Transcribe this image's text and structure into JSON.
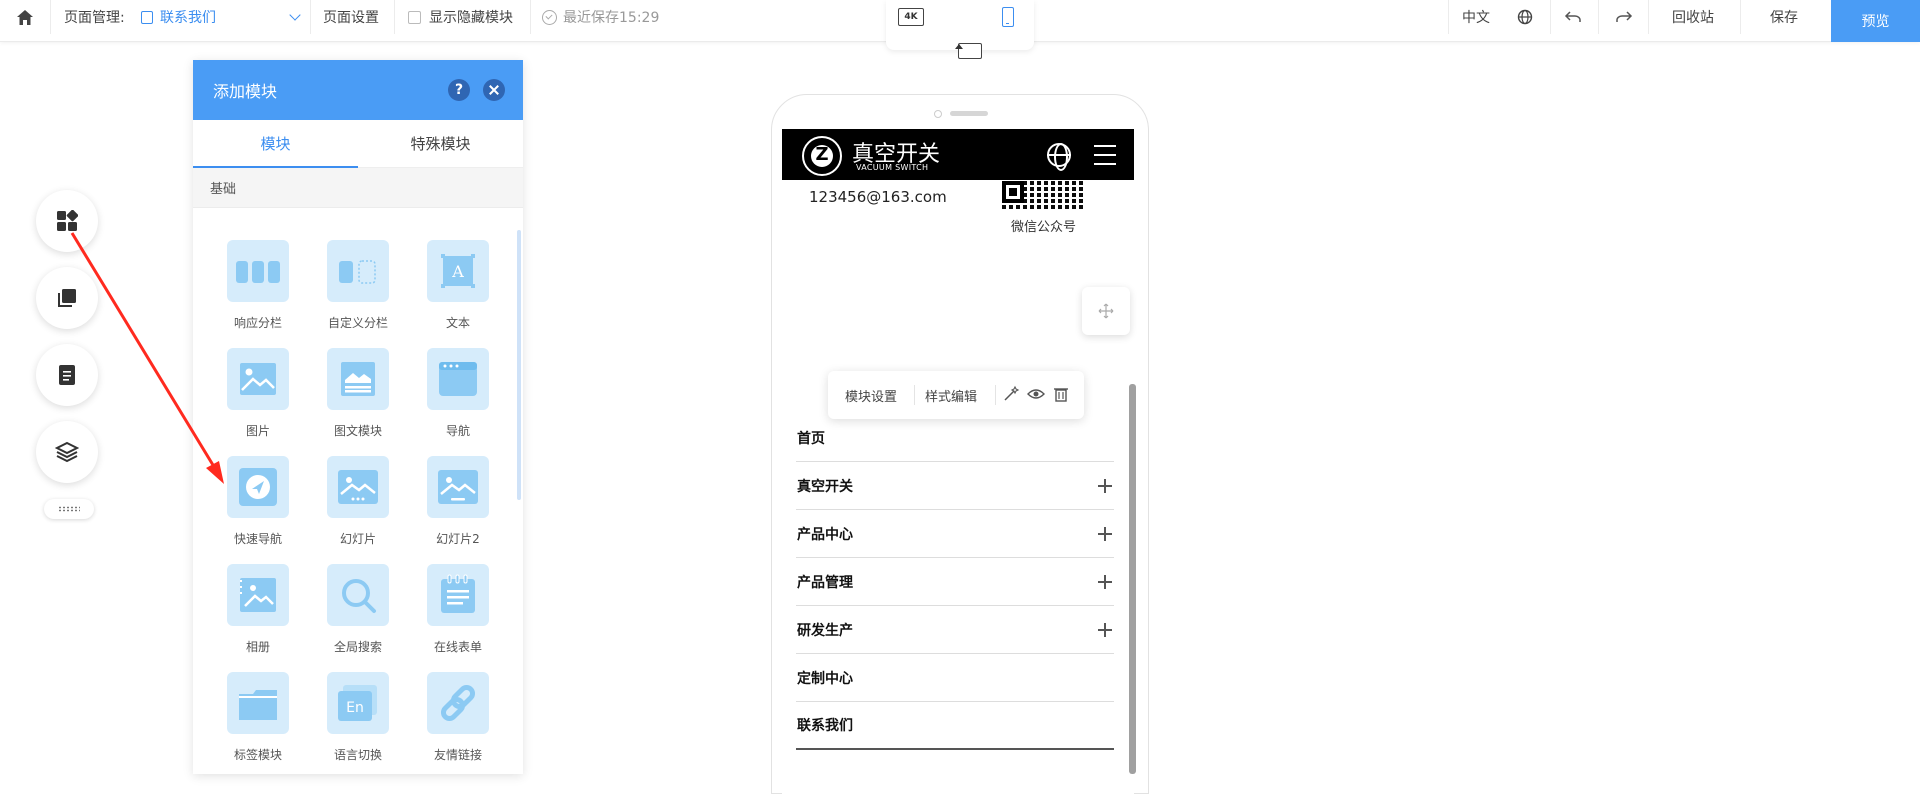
{
  "topbar": {
    "page_manage_label": "页面管理:",
    "current_page": "联系我们",
    "page_settings": "页面设置",
    "show_hidden": "显示隐藏模块",
    "last_save": "最近保存15:29",
    "device_4k": "4K",
    "language": "中文",
    "recycle": "回收站",
    "save": "保存",
    "preview": "预览"
  },
  "panel": {
    "title": "添加模块",
    "help": "?",
    "tabs": [
      "模块",
      "特殊模块"
    ],
    "section": "基础",
    "modules": [
      {
        "label": "响应分栏",
        "icon": "columns-icon"
      },
      {
        "label": "自定义分栏",
        "icon": "custom-columns-icon"
      },
      {
        "label": "文本",
        "icon": "text-icon"
      },
      {
        "label": "图片",
        "icon": "image-icon"
      },
      {
        "label": "图文模块",
        "icon": "image-text-icon"
      },
      {
        "label": "导航",
        "icon": "navigation-icon"
      },
      {
        "label": "快速导航",
        "icon": "quick-nav-icon"
      },
      {
        "label": "幻灯片",
        "icon": "slideshow-icon"
      },
      {
        "label": "幻灯片2",
        "icon": "slideshow-2-icon"
      },
      {
        "label": "相册",
        "icon": "album-icon"
      },
      {
        "label": "全局搜索",
        "icon": "search-icon"
      },
      {
        "label": "在线表单",
        "icon": "form-icon"
      },
      {
        "label": "标签模块",
        "icon": "tab-module-icon"
      },
      {
        "label": "语言切换",
        "icon": "language-switch-icon"
      },
      {
        "label": "友情链接",
        "icon": "link-icon"
      }
    ],
    "en_glyph": "En",
    "text_glyph": "A"
  },
  "site": {
    "logo_cn": "真空开关",
    "logo_en": "VACUUM SWITCH",
    "email": "123456@163.com",
    "qr_caption": "微信公众号",
    "toolbar": {
      "module_settings": "模块设置",
      "style_edit": "样式编辑"
    },
    "nav": [
      {
        "label": "首页",
        "expandable": false
      },
      {
        "label": "真空开关",
        "expandable": true
      },
      {
        "label": "产品中心",
        "expandable": true
      },
      {
        "label": "产品管理",
        "expandable": true
      },
      {
        "label": "研发生产",
        "expandable": true
      },
      {
        "label": "定制中心",
        "expandable": false
      },
      {
        "label": "联系我们",
        "expandable": false
      }
    ]
  },
  "colors": {
    "accent": "#4a9cf5",
    "icon_bg": "#d6ecfb",
    "icon_fg": "#8ccaf3",
    "arrow": "#ff2a1f"
  }
}
